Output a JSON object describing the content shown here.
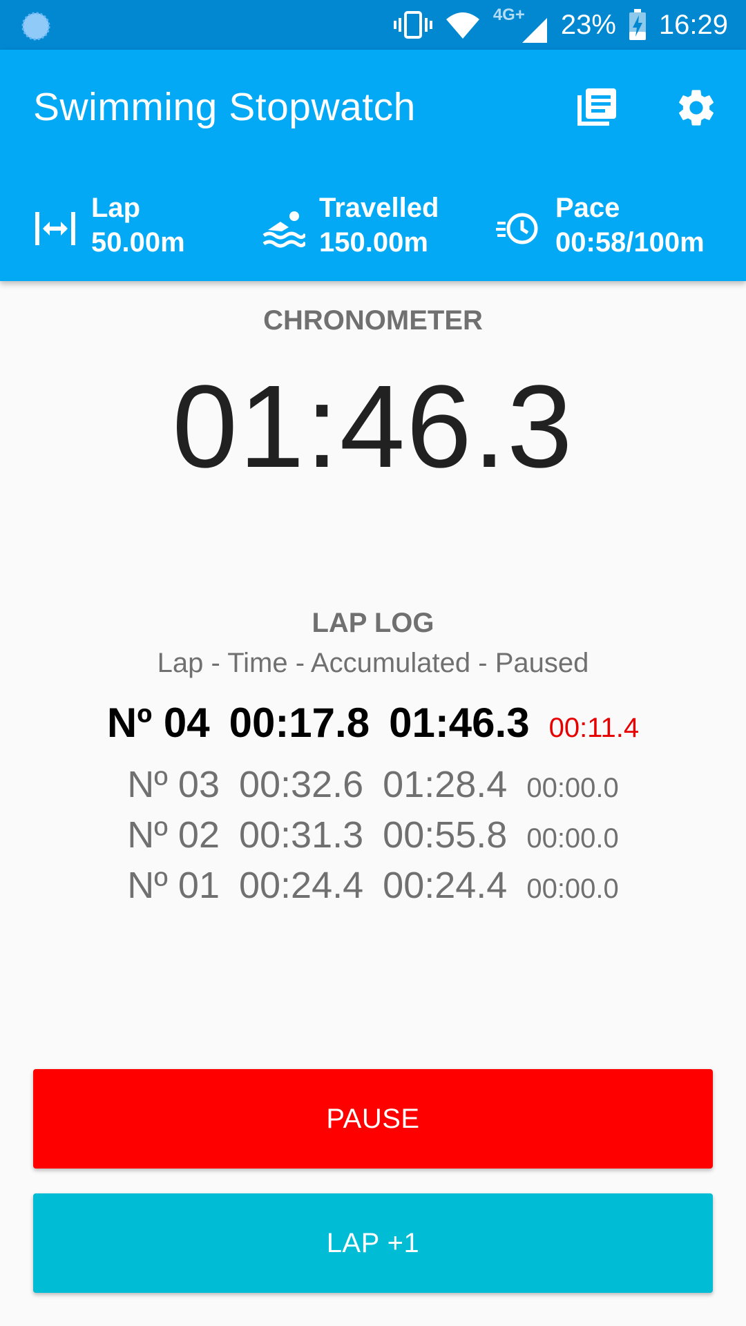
{
  "status_bar": {
    "network": "4G+",
    "battery": "23%",
    "time": "16:29"
  },
  "app_bar": {
    "title": "Swimming Stopwatch",
    "icons": [
      "history-list-icon",
      "settings-gear-icon"
    ]
  },
  "stats": [
    {
      "icon": "lap-distance-icon",
      "label": "Lap",
      "value": "50.00m"
    },
    {
      "icon": "swimmer-icon",
      "label": "Travelled",
      "value": "150.00m"
    },
    {
      "icon": "pace-clock-icon",
      "label": "Pace",
      "value": "00:58/100m"
    }
  ],
  "chronometer": {
    "label": "CHRONOMETER",
    "time": "01:46.3"
  },
  "lap_log": {
    "title": "LAP LOG",
    "subtitle": "Lap - Time - Accumulated - Paused",
    "laps": [
      {
        "number": "Nº 04",
        "time": "00:17.8",
        "accumulated": "01:46.3",
        "paused": "00:11.4"
      },
      {
        "number": "Nº 03",
        "time": "00:32.6",
        "accumulated": "01:28.4",
        "paused": "00:00.0"
      },
      {
        "number": "Nº 02",
        "time": "00:31.3",
        "accumulated": "00:55.8",
        "paused": "00:00.0"
      },
      {
        "number": "Nº 01",
        "time": "00:24.4",
        "accumulated": "00:24.4",
        "paused": "00:00.0"
      }
    ]
  },
  "buttons": {
    "pause": "PAUSE",
    "lap": "LAP +1"
  },
  "colors": {
    "status_bar": "#0288d1",
    "app_bar": "#03a9f4",
    "pause_button": "#ff0000",
    "lap_button": "#00bcd4",
    "paused_current": "#e60000"
  }
}
